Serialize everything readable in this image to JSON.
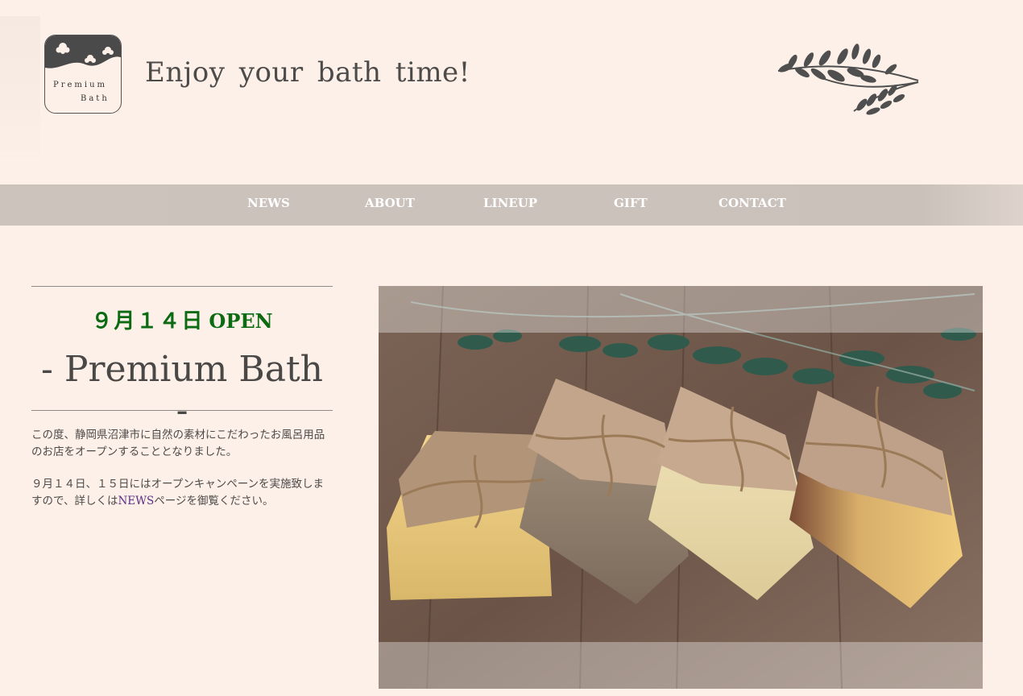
{
  "header": {
    "logo": {
      "line1": "Premium",
      "line2": "Bath"
    },
    "tagline": "Enjoy your bath time!",
    "leaf_icon": "leaf-branch-icon"
  },
  "nav": {
    "items": [
      {
        "label": "NEWS"
      },
      {
        "label": "ABOUT"
      },
      {
        "label": "LINEUP"
      },
      {
        "label": "GIFT"
      },
      {
        "label": "CONTACT"
      }
    ]
  },
  "intro": {
    "open_date": "９月１４日",
    "open_word": "OPEN",
    "brand_title": "- Premium Bath -",
    "paragraph1": "この度、静岡県沼津市に自然の素材にこだわったお風呂用品のお店をオープンすることとなりました。",
    "paragraph2_before": "９月１４日、１５日にはオープンキャンペーンを実施致しますので、詳しくは",
    "paragraph2_link": "NEWS",
    "paragraph2_after": "ページを御覧ください。"
  },
  "hero": {
    "image_subject": "handmade-soap-bars-with-twine-image"
  },
  "colors": {
    "background": "#fdf0e8",
    "nav_bar": "#cbc1bb",
    "accent_green": "#0b6a12",
    "link_purple": "#5a2f86",
    "text_dark": "#4a4846"
  }
}
